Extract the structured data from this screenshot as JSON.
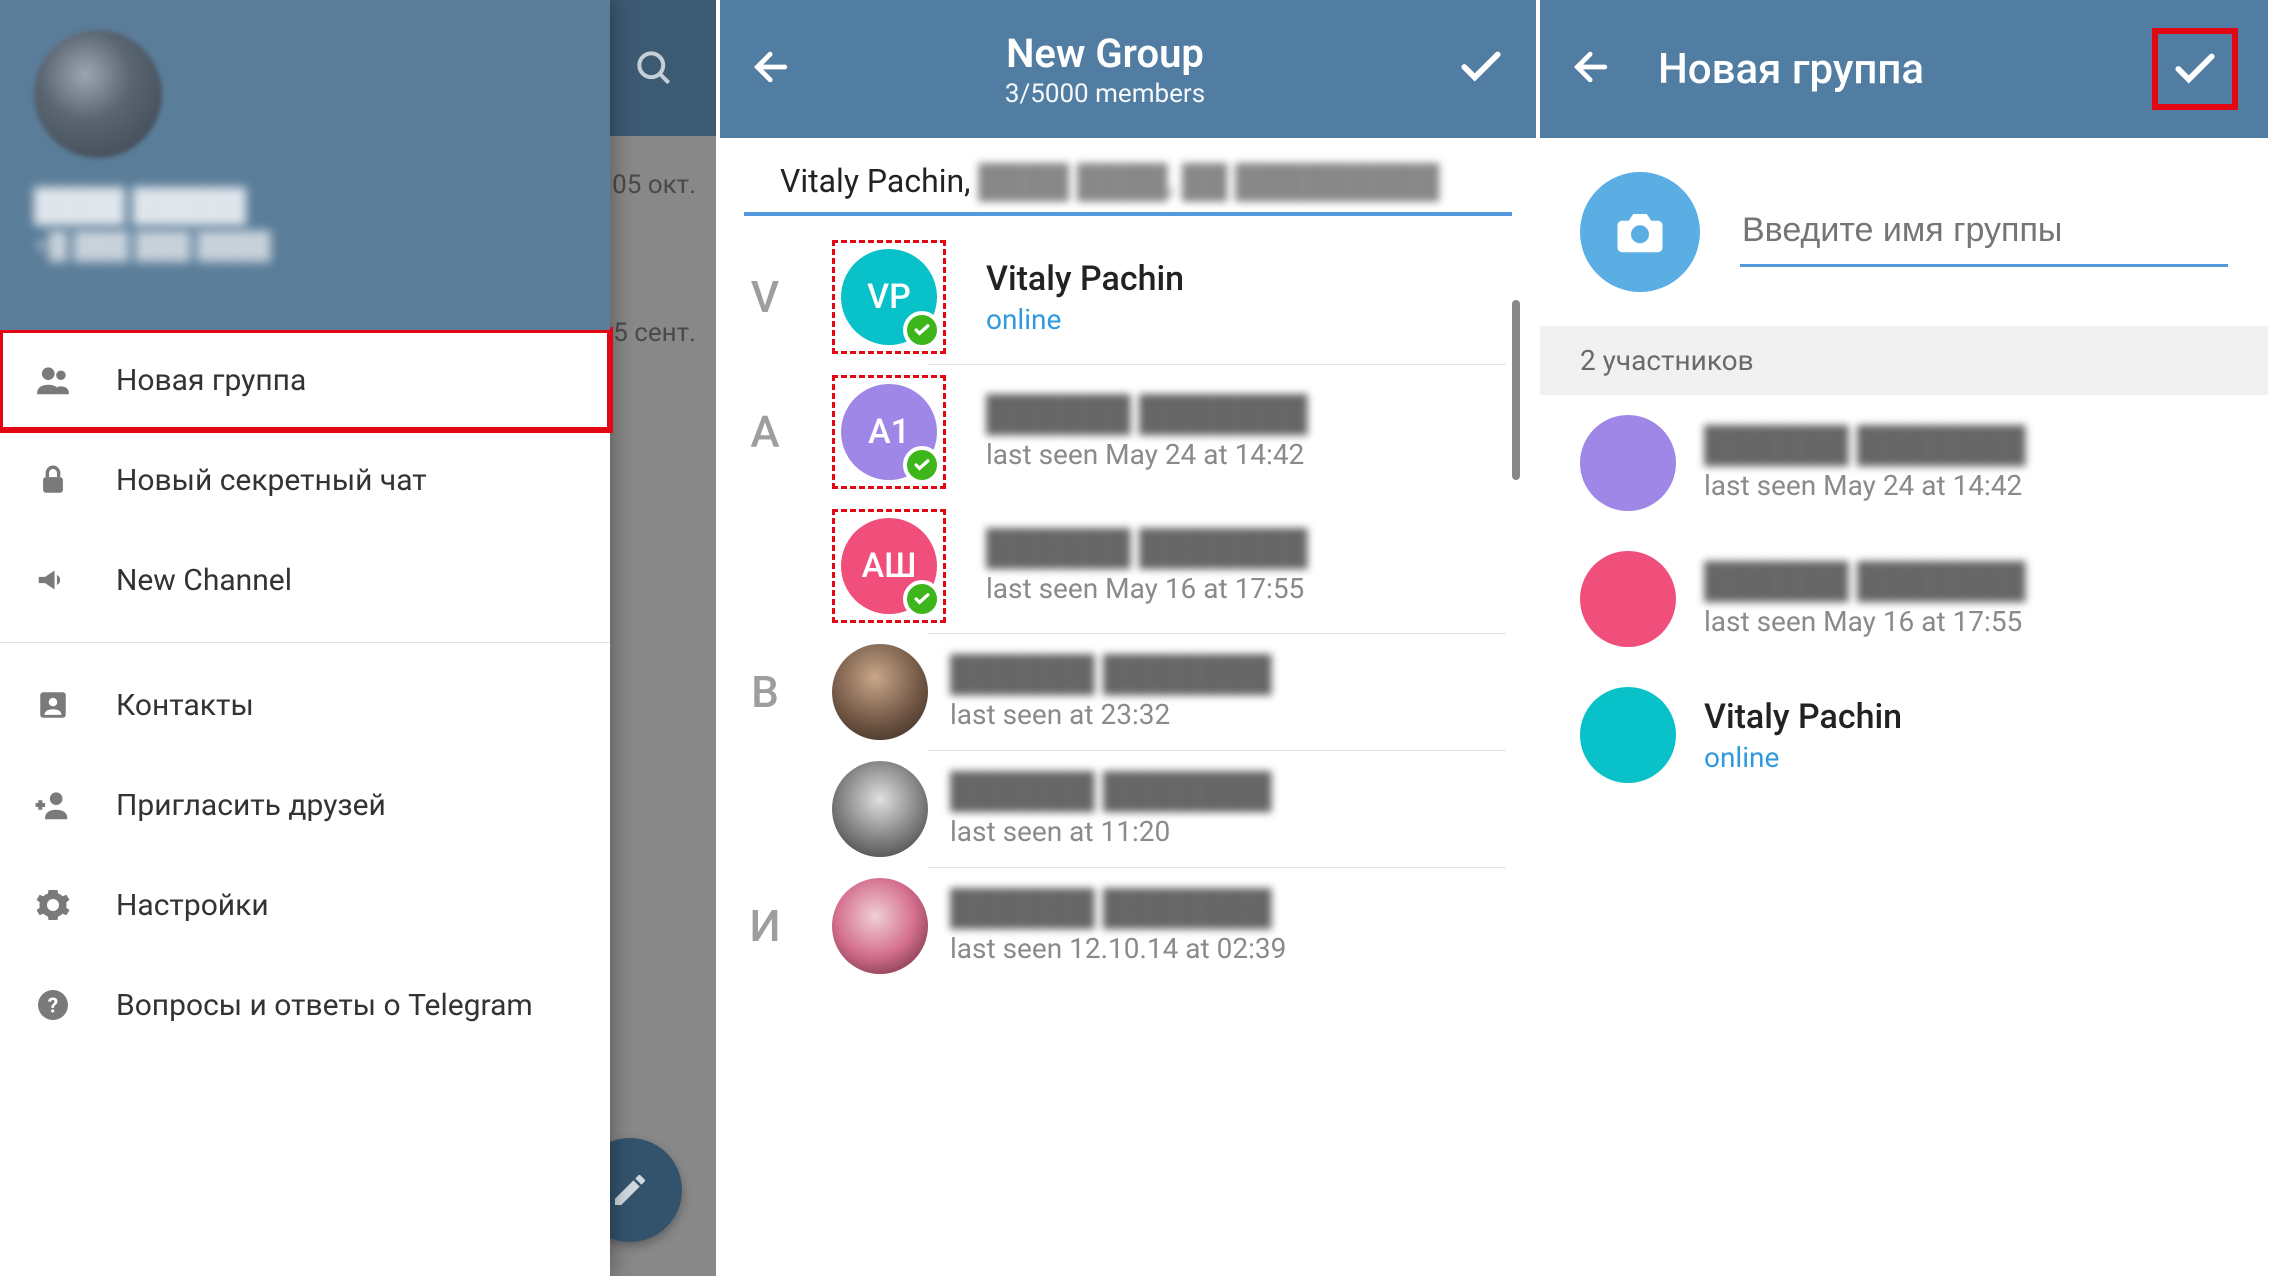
{
  "panel1": {
    "bg_dates": [
      "05 окт.",
      "5 сент."
    ],
    "menu": {
      "new_group": "Новая группа",
      "new_secret_chat": "Новый секретный чат",
      "new_channel": "New Channel",
      "contacts": "Контакты",
      "invite_friends": "Пригласить друзей",
      "settings": "Настройки",
      "faq": "Вопросы и ответы о Telegram"
    }
  },
  "panel2": {
    "title": "New Group",
    "subtitle": "3/5000 members",
    "selected_line_prefix": "Vitaly Pachin, ",
    "contacts": [
      {
        "letter": "V",
        "initials": "VP",
        "color": "#09c1c8",
        "name": "Vitaly Pachin",
        "status": "online",
        "status_class": "online",
        "checked": true,
        "dashed": true
      },
      {
        "letter": "A",
        "initials": "А1",
        "color": "#9f87e8",
        "name": "",
        "status": "last seen May 24 at 14:42",
        "status_class": "",
        "checked": true,
        "dashed": true,
        "blur_name": true
      },
      {
        "letter": "",
        "initials": "АШ",
        "color": "#f04f7c",
        "name": "",
        "status": "last seen May 16 at 17:55",
        "status_class": "",
        "checked": true,
        "dashed": true,
        "blur_name": true
      },
      {
        "letter": "В",
        "photo": "photo",
        "name": "",
        "status": "last seen at 23:32",
        "status_class": "",
        "blur_name": true
      },
      {
        "letter": "",
        "photo": "photo2",
        "name": "",
        "status": "last seen at 11:20",
        "status_class": "",
        "blur_name": true
      },
      {
        "letter": "И",
        "photo": "photo3",
        "name": "",
        "status": "last seen 12.10.14 at 02:39",
        "status_class": "",
        "blur_name": true
      }
    ]
  },
  "panel3": {
    "title": "Новая группа",
    "placeholder": "Введите имя группы",
    "members_header": "2 участников",
    "members": [
      {
        "color": "#9f87e8",
        "name": "",
        "status": "last seen May 24 at 14:42",
        "blur_name": true
      },
      {
        "color": "#f04f7c",
        "name": "",
        "status": "last seen May 16 at 17:55",
        "blur_name": true
      },
      {
        "color": "#09c1c8",
        "name": "Vitaly Pachin",
        "status": "online",
        "status_class": "online"
      }
    ]
  }
}
